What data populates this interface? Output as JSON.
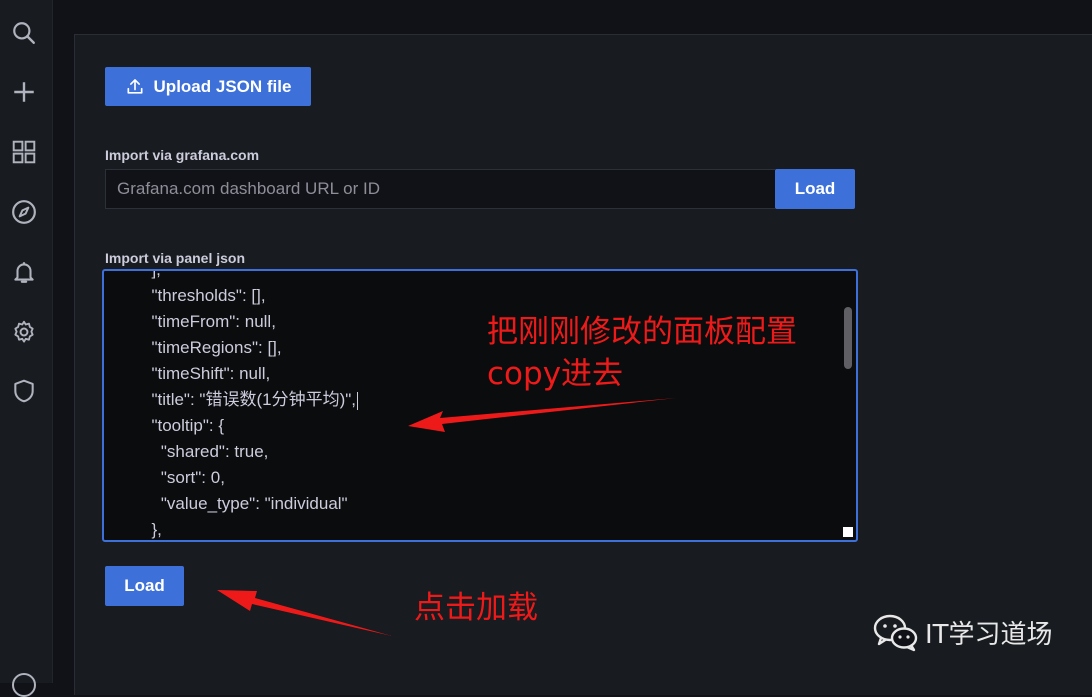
{
  "sidebar": {
    "items": [
      {
        "icon": "search-icon"
      },
      {
        "icon": "plus-icon"
      },
      {
        "icon": "dashboards-grid-icon"
      },
      {
        "icon": "compass-icon"
      },
      {
        "icon": "bell-icon"
      },
      {
        "icon": "gear-icon"
      },
      {
        "icon": "shield-icon"
      }
    ]
  },
  "upload": {
    "label": "Upload JSON file",
    "icon": "upload-icon"
  },
  "grafana_import": {
    "label": "Import via grafana.com",
    "placeholder": "Grafana.com dashboard URL or ID",
    "value": "",
    "button": "Load"
  },
  "panel_json": {
    "label": "Import via panel json",
    "lines": [
      "  ],",
      "  \"thresholds\": [],",
      "  \"timeFrom\": null,",
      "  \"timeRegions\": [],",
      "  \"timeShift\": null,",
      "  \"title\": \"错误数(1分钟平均)\",",
      "  \"tooltip\": {",
      "    \"shared\": true,",
      "    \"sort\": 0,",
      "    \"value_type\": \"individual\"",
      "  },"
    ],
    "button": "Load"
  },
  "annotations": {
    "paste_note_line1": "把刚刚修改的面板配置",
    "paste_note_line2": "copy进去",
    "load_note": "点击加载"
  },
  "watermark": {
    "text": "IT学习道场"
  },
  "colors": {
    "accent": "#3d71d9",
    "annotation": "#ee1a1a",
    "background": "#111217"
  }
}
